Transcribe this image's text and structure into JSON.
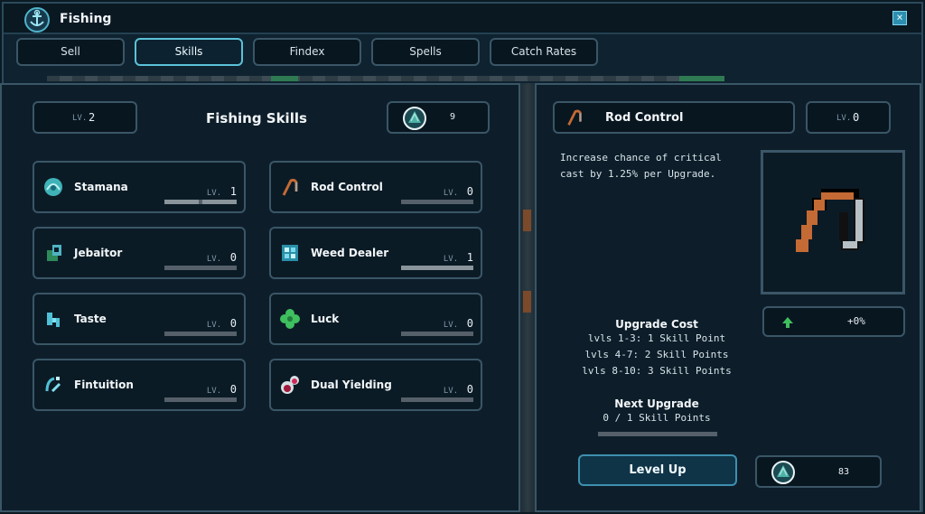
{
  "window": {
    "title": "Fishing",
    "close_label": "×"
  },
  "tabs": [
    {
      "label": "Sell"
    },
    {
      "label": "Skills",
      "active": true
    },
    {
      "label": "Findex"
    },
    {
      "label": "Spells"
    },
    {
      "label": "Catch Rates"
    }
  ],
  "skills_panel": {
    "level_label": "LV.",
    "level_value": "2",
    "title": "Fishing Skills",
    "points": "9"
  },
  "skills": [
    {
      "name": "Stamana",
      "lv_label": "LV.",
      "lv": "1",
      "icon": "shell-icon",
      "progress": 1
    },
    {
      "name": "Rod Control",
      "lv_label": "LV.",
      "lv": "0",
      "icon": "rod-icon",
      "progress": 0
    },
    {
      "name": "Jebaitor",
      "lv_label": "LV.",
      "lv": "0",
      "icon": "bait-icon",
      "progress": 0
    },
    {
      "name": "Weed Dealer",
      "lv_label": "LV.",
      "lv": "1",
      "icon": "weed-icon",
      "progress": 1
    },
    {
      "name": "Taste",
      "lv_label": "LV.",
      "lv": "0",
      "icon": "taste-icon",
      "progress": 0
    },
    {
      "name": "Luck",
      "lv_label": "LV.",
      "lv": "0",
      "icon": "clover-icon",
      "progress": 0
    },
    {
      "name": "Fintuition",
      "lv_label": "LV.",
      "lv": "0",
      "icon": "fintuition-icon",
      "progress": 0
    },
    {
      "name": "Dual Yielding",
      "lv_label": "LV.",
      "lv": "0",
      "icon": "potion-icon",
      "progress": 0
    }
  ],
  "detail": {
    "skill_name": "Rod Control",
    "lv_label": "LV.",
    "lv": "0",
    "description_1": "Increase chance of critical",
    "description_2": "cast by 1.25% per Upgrade.",
    "bonus": "+0%",
    "upgrade_cost_title": "Upgrade Cost",
    "cost_1": "lvls 1-3: 1 Skill Point",
    "cost_2": "lvls 4-7: 2 Skill Points",
    "cost_3": "lvls 8-10: 3 Skill Points",
    "next_upgrade_title": "Next Upgrade",
    "next_upgrade_value": "0 / 1 Skill Points",
    "level_up_label": "Level Up",
    "currency": "83"
  },
  "colors": {
    "accent": "#5bc2d8",
    "panel_border": "#3a5667",
    "background": "#0d1e2a"
  }
}
